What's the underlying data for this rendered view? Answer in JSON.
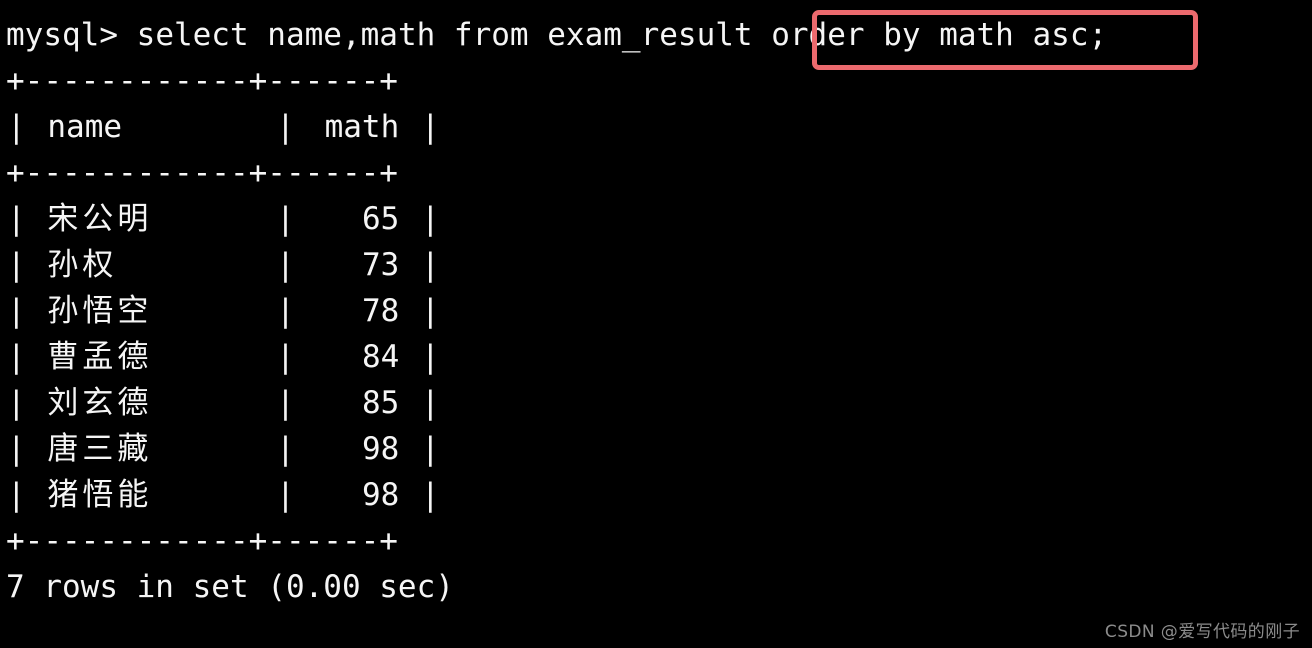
{
  "terminal": {
    "background_color": "#000000",
    "foreground_color": "#f5f5f5",
    "prompt": "mysql> ",
    "command_before_highlight": "select name,math from exam_result ",
    "command_highlighted": "order by math asc;",
    "full_command_line": "mysql> select name,math from exam_result order by math asc;",
    "separator_line": "+------------+------+",
    "footer": "7 rows in set (0.00 sec)"
  },
  "highlight": {
    "color": "#ec6a6e",
    "border_width_px": 5,
    "target_text": "order by math asc;"
  },
  "table": {
    "columns": [
      "name",
      "math"
    ],
    "header_cells": {
      "name": "name",
      "math": "math"
    },
    "rows": [
      {
        "name": "宋公明",
        "math": "65"
      },
      {
        "name": "孙权",
        "math": "73"
      },
      {
        "name": "孙悟空",
        "math": "78"
      },
      {
        "name": "曹孟德",
        "math": "84"
      },
      {
        "name": "刘玄德",
        "math": "85"
      },
      {
        "name": "唐三藏",
        "math": "98"
      },
      {
        "name": "猪悟能",
        "math": "98"
      }
    ],
    "row_count": 7
  },
  "watermark": {
    "text": "CSDN @爱写代码的刚子"
  }
}
